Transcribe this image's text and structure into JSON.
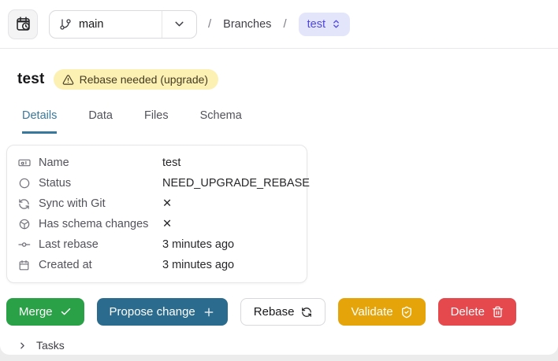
{
  "colors": {
    "accent_tab": "#38789d",
    "merge_green": "#2aa147",
    "propose_blue": "#2b6b8d",
    "validate_amber": "#e5a50a",
    "delete_red": "#e5484d",
    "badge_yellow_bg": "#fcf0b3",
    "breadcrumb_pill_bg": "#e3e6fb",
    "breadcrumb_pill_text": "#4f46e5"
  },
  "header": {
    "history_button": {
      "icon": "calendar-clock-icon"
    },
    "branch_selector": {
      "icon": "git-branch-icon",
      "value": "main"
    },
    "breadcrumb": {
      "separator": "/",
      "section": "Branches",
      "current": "test"
    }
  },
  "page": {
    "title": "test",
    "status_badge": {
      "icon": "warning-triangle-icon",
      "label": "Rebase needed (upgrade)"
    }
  },
  "tabs": [
    {
      "label": "Details",
      "active": true
    },
    {
      "label": "Data",
      "active": false
    },
    {
      "label": "Files",
      "active": false
    },
    {
      "label": "Schema",
      "active": false
    }
  ],
  "details": {
    "rows": [
      {
        "icon": "input-name-icon",
        "label": "Name",
        "value": "test"
      },
      {
        "icon": "status-circle-icon",
        "label": "Status",
        "value": "NEED_UPGRADE_REBASE"
      },
      {
        "icon": "sync-icon",
        "label": "Sync with Git",
        "value": "✕"
      },
      {
        "icon": "schema-box-icon",
        "label": "Has schema changes",
        "value": "✕"
      },
      {
        "icon": "commit-icon",
        "label": "Last rebase",
        "value": "3 minutes ago"
      },
      {
        "icon": "calendar-icon",
        "label": "Created at",
        "value": "3 minutes ago"
      }
    ]
  },
  "actions": [
    {
      "label": "Merge",
      "icon": "check-icon"
    },
    {
      "label": "Propose change",
      "icon": "plus-icon"
    },
    {
      "label": "Rebase",
      "icon": "refresh-icon"
    },
    {
      "label": "Validate",
      "icon": "shield-check-icon"
    },
    {
      "label": "Delete",
      "icon": "trash-icon"
    }
  ],
  "tasks": {
    "label": "Tasks",
    "icon": "chevron-right-icon"
  }
}
